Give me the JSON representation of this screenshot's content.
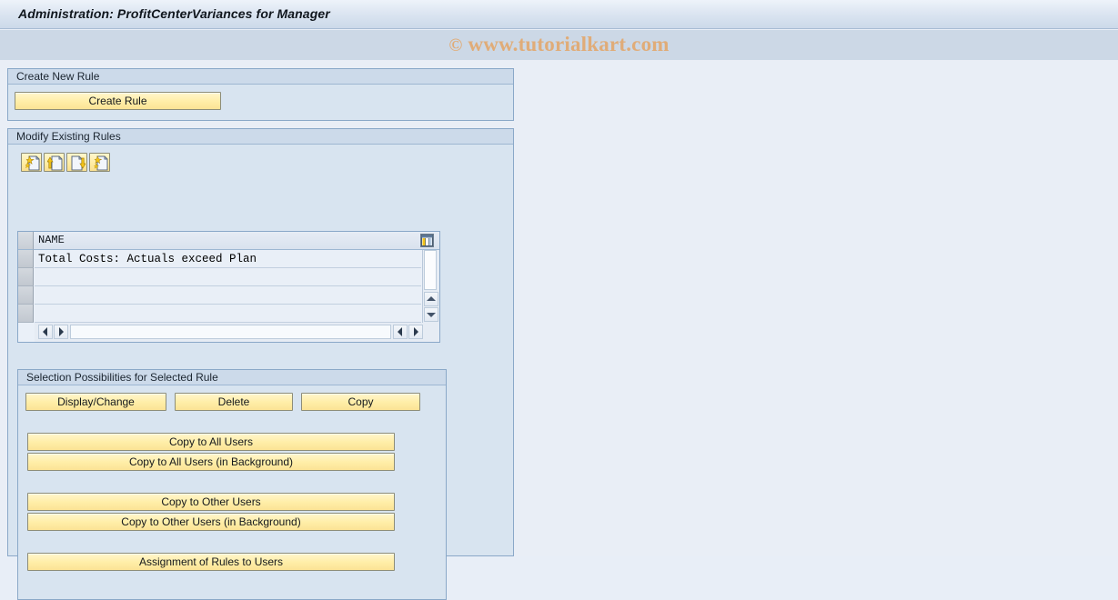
{
  "window": {
    "title": "Administration: ProfitCenterVariances for Manager"
  },
  "watermark": {
    "copyright": "©",
    "text": "www.tutorialkart.com"
  },
  "create_group": {
    "legend": "Create New Rule",
    "create_rule_label": "Create Rule"
  },
  "modify_group": {
    "legend": "Modify Existing Rules",
    "toolbar": [
      {
        "name": "create-rule-icon",
        "tooltip": "Create"
      },
      {
        "name": "upload-rule-icon",
        "tooltip": "Upload"
      },
      {
        "name": "download-rule-icon",
        "tooltip": "Download"
      },
      {
        "name": "change-rule-icon",
        "tooltip": "Change"
      }
    ],
    "table": {
      "settings_icon": "table-settings-icon",
      "columns": [
        "NAME"
      ],
      "rows": [
        {
          "NAME": "Total Costs: Actuals exceed Plan"
        },
        {
          "NAME": ""
        },
        {
          "NAME": ""
        },
        {
          "NAME": ""
        }
      ]
    }
  },
  "selection_group": {
    "legend": "Selection Possibilities for Selected Rule",
    "buttons": {
      "display_change": "Display/Change",
      "delete": "Delete",
      "copy": "Copy",
      "copy_all_users": "Copy to All Users",
      "copy_all_users_bg": "Copy to All Users (in Background)",
      "copy_other_users": "Copy to Other Users",
      "copy_other_users_bg": "Copy to Other Users (in Background)",
      "assignment": "Assignment of Rules to Users"
    }
  },
  "colors": {
    "app_background": "#e9eef6",
    "group_background": "#d8e4f0",
    "group_header": "#ccdaea",
    "button_yellow": "#ffeea8",
    "title_band": "#dde6f2",
    "watermark": "#e0ac78"
  }
}
